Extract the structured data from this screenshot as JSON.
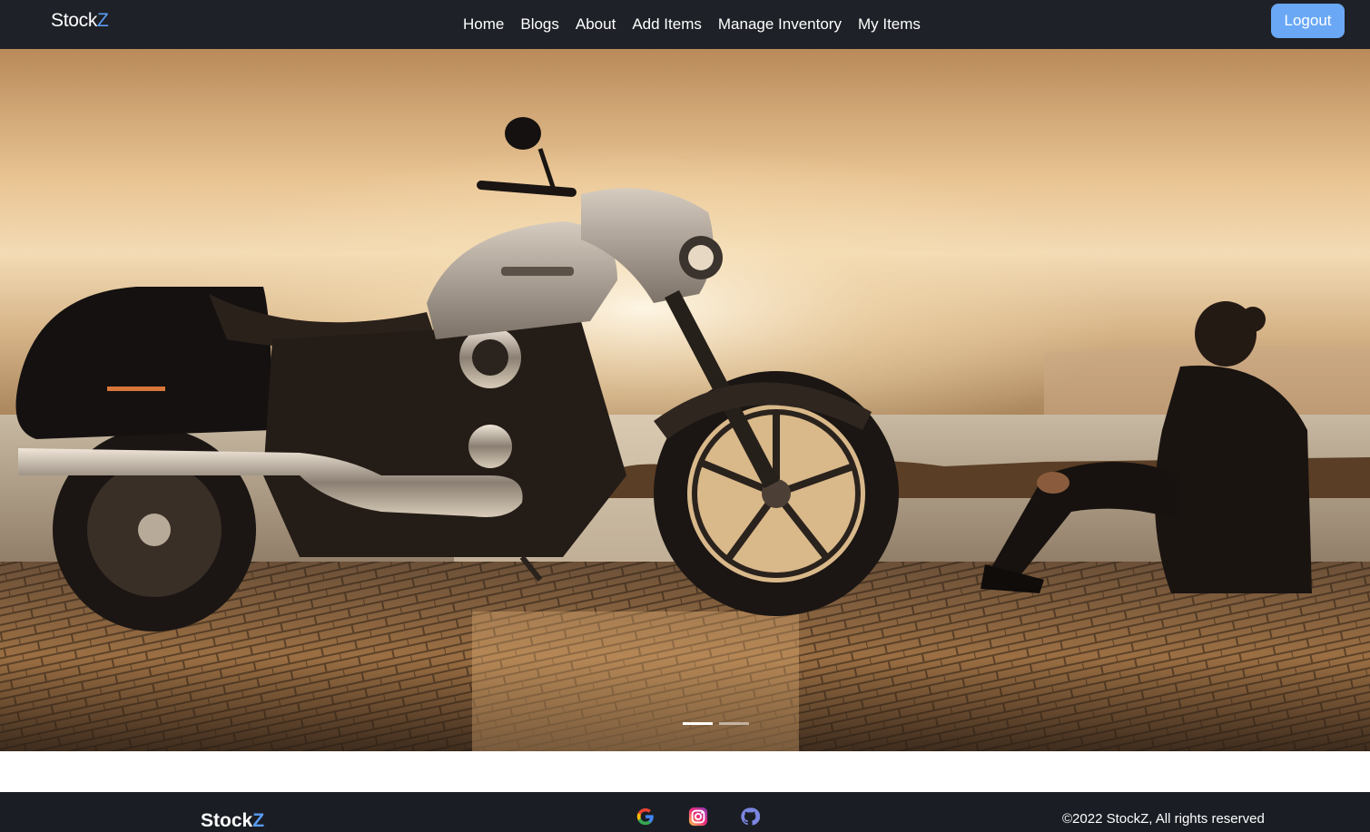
{
  "navbar": {
    "brand_main": "Stock",
    "brand_accent": "Z",
    "links": [
      "Home",
      "Blogs",
      "About",
      "Add Items",
      "Manage Inventory",
      "My Items"
    ],
    "logout_label": "Logout"
  },
  "hero": {
    "image": "motorcycle-sunset-photo",
    "indicators": 2,
    "active_indicator": 1
  },
  "footer": {
    "brand_main": "Stock",
    "brand_accent": "Z",
    "social_icons": [
      "google-icon",
      "instagram-icon",
      "github-icon"
    ],
    "copyright": "©2022 StockZ, All rights reserved"
  },
  "colors": {
    "navbar_bg": "#1e2127",
    "accent": "#5a9cf4",
    "logout_bg": "#6aa8f5",
    "footer_bg": "#1a1e24"
  }
}
